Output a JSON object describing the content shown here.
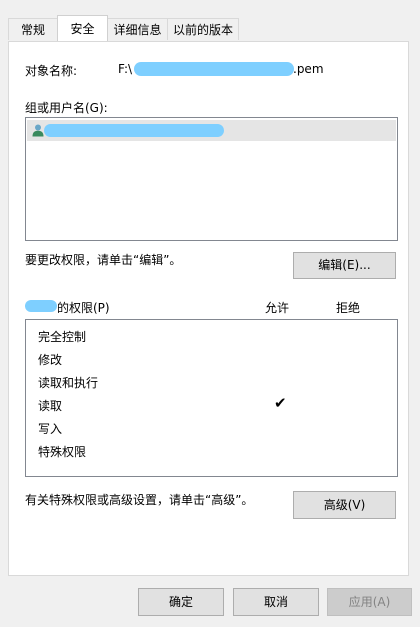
{
  "tabs": [
    {
      "label": "常规"
    },
    {
      "label": "安全"
    },
    {
      "label": "详细信息"
    },
    {
      "label": "以前的版本"
    }
  ],
  "object_name": {
    "label": "对象名称:",
    "value_prefix": "F:\\",
    "value_suffix": ".pem"
  },
  "groups": {
    "label": "组或用户名(G):"
  },
  "edit_hint": "要更改权限，请单击“编辑”。",
  "edit_button": "编辑(E)...",
  "permissions": {
    "header_suffix": "的权限(P)",
    "allow_header": "允许",
    "deny_header": "拒绝",
    "items": [
      {
        "name": "完全控制",
        "allow": false,
        "deny": false
      },
      {
        "name": "修改",
        "allow": false,
        "deny": false
      },
      {
        "name": "读取和执行",
        "allow": false,
        "deny": false
      },
      {
        "name": "读取",
        "allow": true,
        "deny": false
      },
      {
        "name": "写入",
        "allow": false,
        "deny": false
      },
      {
        "name": "特殊权限",
        "allow": false,
        "deny": false
      }
    ],
    "check_mark": "✔"
  },
  "advanced_hint": "有关特殊权限或高级设置，请单击“高级”。",
  "advanced_button": "高级(V)",
  "footer": {
    "ok": "确定",
    "cancel": "取消",
    "apply": "应用(A)"
  }
}
